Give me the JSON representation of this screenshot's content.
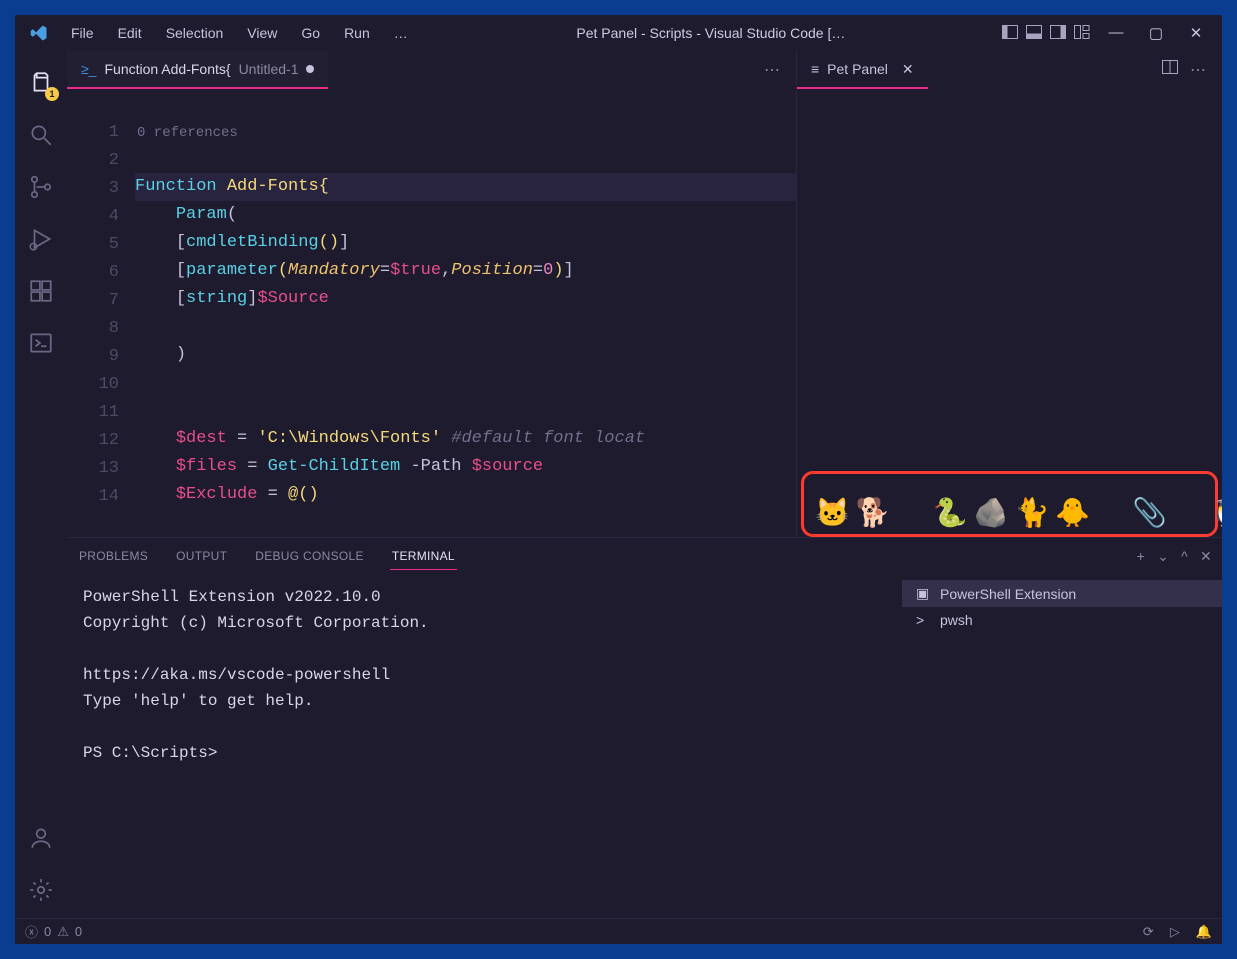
{
  "window": {
    "title": "Pet Panel - Scripts - Visual Studio Code […"
  },
  "menu": [
    "File",
    "Edit",
    "Selection",
    "View",
    "Go",
    "Run"
  ],
  "menu_ellipsis": "…",
  "activity_badge": "1",
  "editor_tab": {
    "icon_label": "≥",
    "filename": "Function Add-Fonts{",
    "untitled": "Untitled-1"
  },
  "pet_tab": {
    "label": "Pet Panel"
  },
  "codelens": "0 references",
  "line_numbers": [
    "1",
    "2",
    "3",
    "4",
    "5",
    "6",
    "7",
    "8",
    "9",
    "10",
    "11",
    "12",
    "13",
    "14"
  ],
  "code": {
    "l1_kw": "Function",
    "l1_fn": "Add-Fonts",
    "l1_br": "{",
    "l2_kw": "Param",
    "l2_p": "(",
    "l3_o": "[",
    "l3_a": "cmdletBinding",
    "l3_p": "()",
    "l3_c": "]",
    "l4_o": "[",
    "l4_a": "parameter",
    "l4_po": "(",
    "l4_m": "Mandatory",
    "l4_eq": "=",
    "l4_t": "$true",
    "l4_cm": ",",
    "l4_p": "Position",
    "l4_eq2": "=",
    "l4_n": "0",
    "l4_pc": ")",
    "l4_c": "]",
    "l5_o": "[",
    "l5_t": "string",
    "l5_c": "]",
    "l5_v": "$Source",
    "l7_p": ")",
    "l10_v": "$dest",
    "l10_eq": " = ",
    "l10_s": "'C:\\Windows\\Fonts'",
    "l10_cm": " #default font locat",
    "l11_v": "$files",
    "l11_eq": " = ",
    "l11_cmd": "Get-ChildItem",
    "l11_f": " -Path ",
    "l11_var": "$source",
    "l12_v": "$Exclude",
    "l12_eq": " = ",
    "l12_a": "@()"
  },
  "panel_tabs": [
    "PROBLEMS",
    "OUTPUT",
    "DEBUG CONSOLE",
    "TERMINAL"
  ],
  "terminal_output": "PowerShell Extension v2022.10.0\nCopyright (c) Microsoft Corporation.\n\nhttps://aka.ms/vscode-powershell\nType 'help' to get help.\n\nPS C:\\Scripts>",
  "terminal_list": [
    {
      "name": "PowerShell Extension",
      "icon": "▣"
    },
    {
      "name": "pwsh",
      "icon": ">"
    }
  ],
  "status": {
    "errors": "0",
    "warnings": "0"
  },
  "pets": [
    "🐱",
    "🐕",
    "🐍",
    "🪨",
    "🐈",
    "🐥",
    "📎",
    "🐧"
  ]
}
